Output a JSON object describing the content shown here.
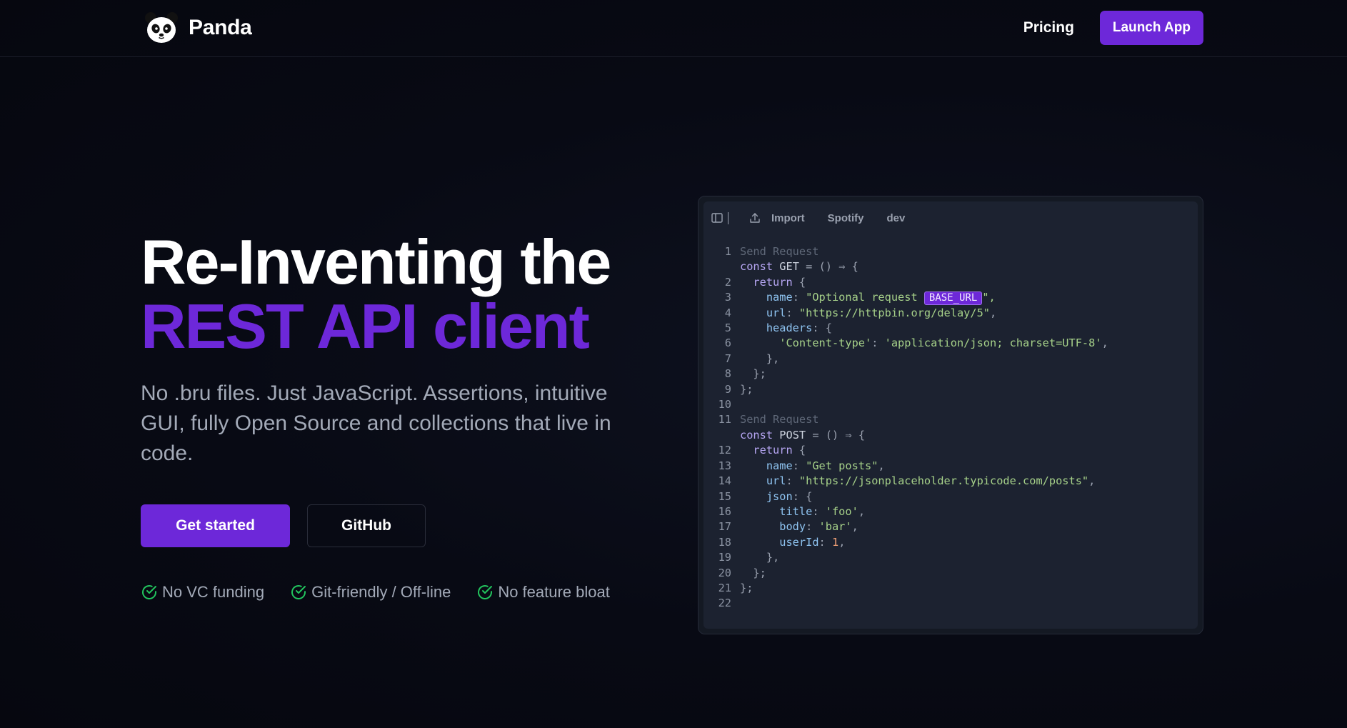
{
  "nav": {
    "brand_name": "Panda",
    "logo_icon": "panda-logo-icon",
    "links": [
      {
        "label": "Pricing"
      }
    ],
    "launch_label": "Launch App"
  },
  "hero": {
    "title_line1": "Re-Inventing the",
    "title_line2": "REST API client",
    "subtitle": "No .bru files. Just JavaScript. Assertions, intuitive GUI, fully Open Source and collections that live in code.",
    "primary_cta": "Get started",
    "secondary_cta": "GitHub",
    "features": [
      {
        "label": "No VC funding",
        "icon": "check-circle-icon"
      },
      {
        "label": "Git-friendly / Off-line",
        "icon": "check-circle-icon"
      },
      {
        "label": "No feature bloat",
        "icon": "check-circle-icon"
      }
    ]
  },
  "editor": {
    "toolbar": {
      "sidebar_icon": "sidebar-toggle-icon",
      "upload_icon": "upload-icon",
      "import_label": "Import",
      "collection_label": "Spotify",
      "env_label": "dev"
    },
    "codelens": [
      "Send Request",
      "Send Request"
    ],
    "line_numbers": [
      "1",
      "2",
      "3",
      "4",
      "5",
      "6",
      "7",
      "8",
      "9",
      "10",
      "11",
      "12",
      "13",
      "14",
      "15",
      "16",
      "17",
      "18",
      "19",
      "20",
      "21",
      "22"
    ],
    "env_tag": "BASE_URL",
    "strings": {
      "get_name": "\"Optional request ",
      "get_name_end": "\",",
      "get_url": "\"https://httpbin.org/delay/5\"",
      "content_type_key": "'Content-type'",
      "content_type_val": "'application/json; charset=UTF-8'",
      "post_name": "\"Get posts\"",
      "post_url": "\"https://jsonplaceholder.typicode.com/posts\"",
      "title_val": "'foo'",
      "body_val": "'bar'",
      "user_id_val": "1"
    }
  },
  "colors": {
    "accent": "#6d28d9",
    "background": "#070812",
    "muted_text": "#a3aab8",
    "check": "#22c55e"
  }
}
